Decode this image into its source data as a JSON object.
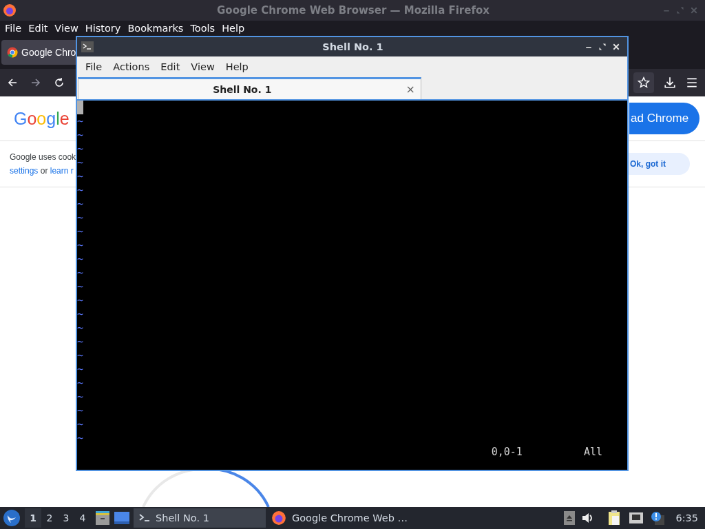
{
  "browser": {
    "window_title": "Google Chrome Web Browser — Mozilla Firefox",
    "menu": [
      "File",
      "Edit",
      "View",
      "History",
      "Bookmarks",
      "Tools",
      "Help"
    ],
    "tabs": [
      {
        "label": "Google Chro",
        "selected": true
      }
    ],
    "page": {
      "logo": "Google",
      "download_button": "ad Chrome",
      "cookie_text": "Google uses cook",
      "settings_link": "settings",
      "or_text": "or",
      "learn_link": "learn r",
      "ok_button": "Ok, got it"
    }
  },
  "terminal": {
    "window_title": "Shell No. 1",
    "menu": [
      "File",
      "Actions",
      "Edit",
      "View",
      "Help"
    ],
    "tabs": [
      {
        "label": "Shell No. 1",
        "close": "×",
        "selected": true
      }
    ],
    "empty_lines": [
      "~",
      "~",
      "~",
      "~",
      "~",
      "~",
      "~",
      "~",
      "~",
      "~",
      "~",
      "~",
      "~",
      "~",
      "~",
      "~",
      "~",
      "~",
      "~",
      "~",
      "~",
      "~",
      "~",
      "~"
    ],
    "status": {
      "position": "0,0-1",
      "scroll": "All"
    }
  },
  "taskbar": {
    "workspaces": [
      {
        "label": "1",
        "selected": true
      },
      {
        "label": "2",
        "selected": false
      },
      {
        "label": "3",
        "selected": false
      },
      {
        "label": "4",
        "selected": false
      }
    ],
    "tasks": [
      {
        "kind": "terminal",
        "label": "Shell No. 1",
        "selected": true
      },
      {
        "kind": "firefox",
        "label": "Google Chrome Web …",
        "selected": false
      }
    ],
    "clock": "6:35"
  }
}
